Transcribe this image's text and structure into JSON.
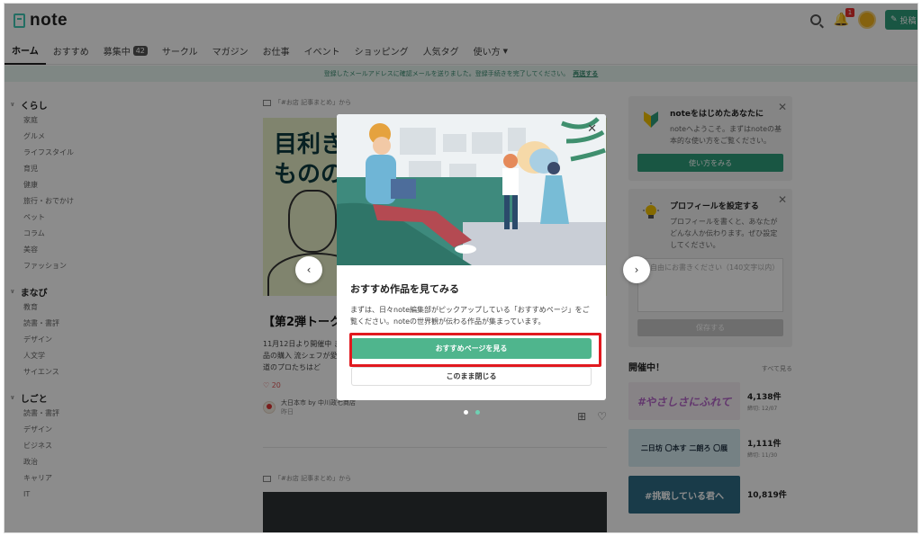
{
  "header": {
    "logo_text": "note",
    "notification_count": "1",
    "post_label": "投稿"
  },
  "nav": {
    "items": [
      {
        "label": "ホーム"
      },
      {
        "label": "おすすめ"
      },
      {
        "label": "募集中",
        "badge": "42"
      },
      {
        "label": "サークル"
      },
      {
        "label": "マガジン"
      },
      {
        "label": "お仕事"
      },
      {
        "label": "イベント"
      },
      {
        "label": "ショッピング"
      },
      {
        "label": "人気タグ"
      },
      {
        "label": "使い方"
      }
    ]
  },
  "infobar": {
    "text": "登録したメールアドレスに確認メールを送りました。登録手続きを完了してください。",
    "link": "再送する"
  },
  "sidebar": {
    "groups": [
      {
        "title": "くらし",
        "items": [
          "家庭",
          "グルメ",
          "ライフスタイル",
          "育児",
          "健康",
          "旅行・おでかけ",
          "ペット",
          "コラム",
          "美容",
          "ファッション"
        ]
      },
      {
        "title": "まなび",
        "items": [
          "教育",
          "読書・書評",
          "デザイン",
          "人文学",
          "サイエンス"
        ]
      },
      {
        "title": "しごと",
        "items": [
          "読書・書評",
          "デザイン",
          "ビジネス",
          "政治",
          "キャリア",
          "IT"
        ]
      }
    ]
  },
  "feed": {
    "source": "「#お店 記事まとめ」から",
    "hero_text_line1": "目利き",
    "hero_text_line2": "ものの",
    "title": "【第2弾トーク",
    "excerpt": "11月12日より開催中 ます。●商品の購入 流シェフが愛用する の道のプロたちはど",
    "likes": "20",
    "author": "大日本市 by 中川政七商店",
    "date": "昨日",
    "source2": "「#お店 記事まとめ」から"
  },
  "right": {
    "card1": {
      "title": "noteをはじめたあなたに",
      "text": "noteへようこそ。まずはnoteの基本的な使い方をご覧ください。",
      "button": "使い方をみる"
    },
    "card2": {
      "title": "プロフィールを設定する",
      "text": "プロフィールを書くと、あなたがどんな人か伝わります。ぜひ設定してください。",
      "placeholder": "ご自由にお書きください（140文字以内）",
      "button": "保存する"
    },
    "events": {
      "title": "開催中！",
      "see_all": "すべて見る",
      "items": [
        {
          "thumb": "#やさしさにふれて",
          "count": "4,138件",
          "period": "締切: 12/07"
        },
        {
          "thumb": "二日坊 〇本す 二朗ろ 〇展",
          "count": "1,111件",
          "period": "締切: 11/30"
        },
        {
          "thumb": "#挑戦している君へ",
          "count": "10,819件",
          "period": ""
        }
      ]
    }
  },
  "modal": {
    "title": "おすすめ作品を見てみる",
    "desc": "まずは、日々note編集部がピックアップしている「おすすめページ」をご覧ください。noteの世界観が伝わる作品が集まっています。",
    "primary": "おすすめページを見る",
    "secondary": "このまま閉じる"
  }
}
